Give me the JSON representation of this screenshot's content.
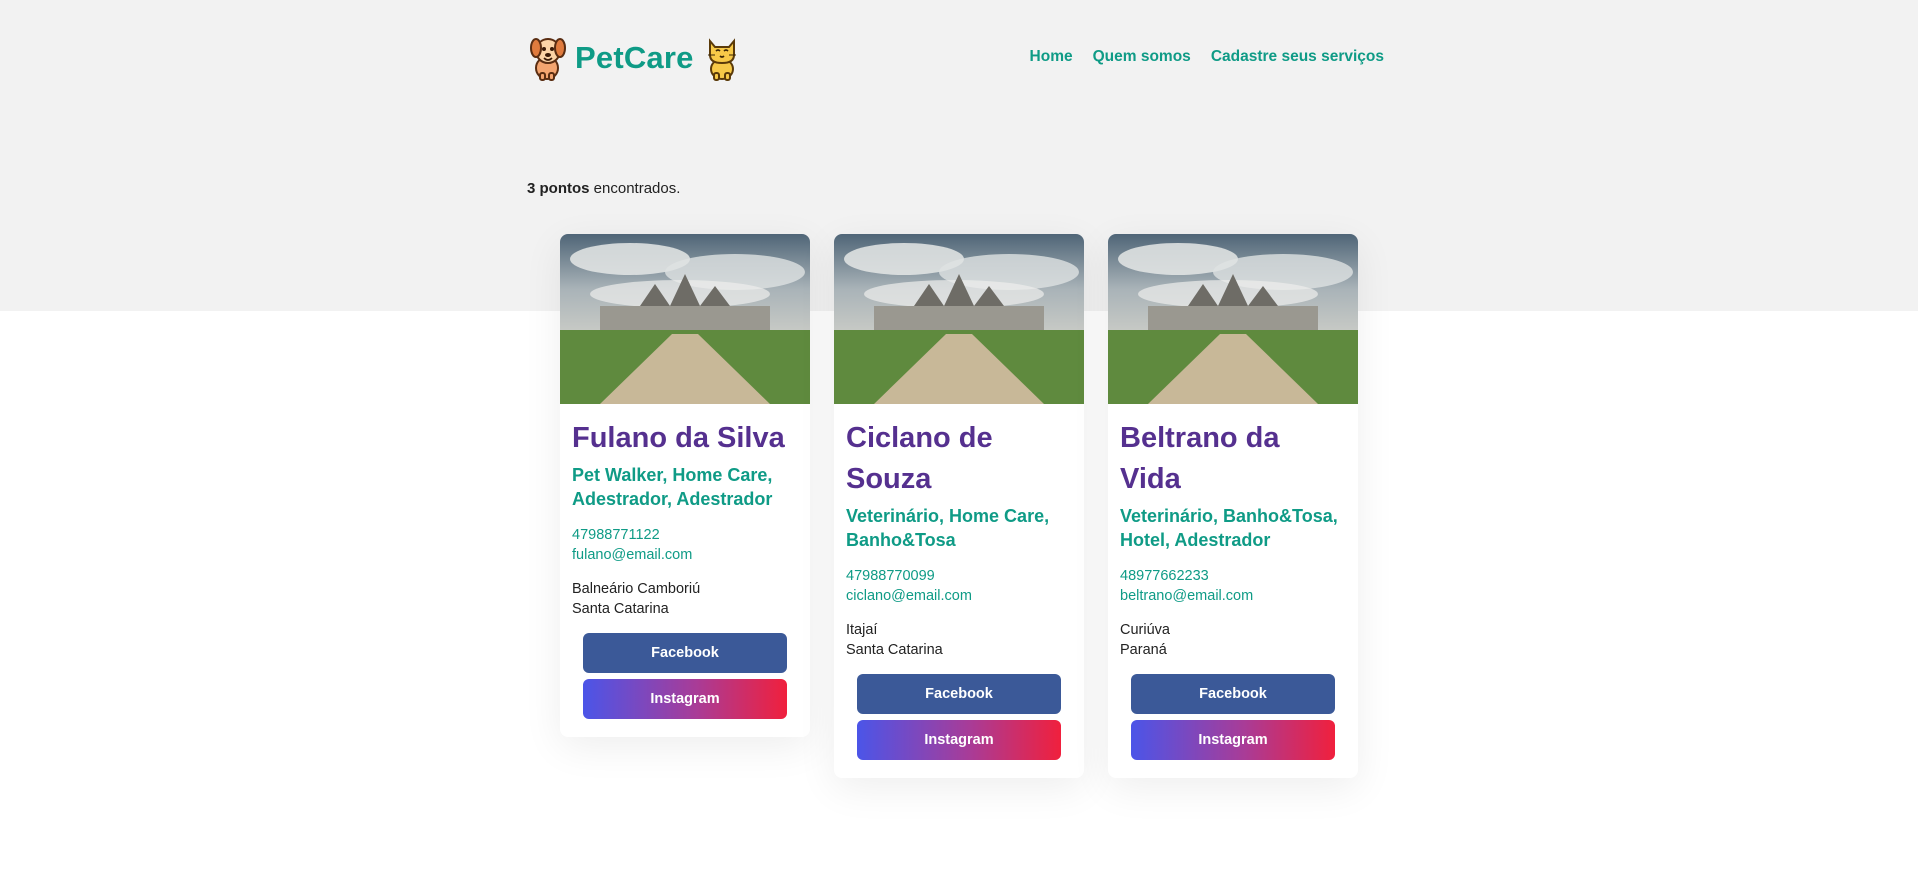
{
  "brand": {
    "name": "PetCare",
    "left_icon": "dog-icon",
    "right_icon": "cat-icon",
    "color": "#0f9b86"
  },
  "nav": {
    "home": "Home",
    "about": "Quem somos",
    "register": "Cadastre seus serviços"
  },
  "results": {
    "count": "3 pontos",
    "suffix": " encontrados."
  },
  "colors": {
    "name": "#55308f",
    "accent": "#0f9b86",
    "facebook": "#3b5998",
    "instagram_start": "#4b55e8",
    "instagram_end": "#f0203d"
  },
  "cards": [
    {
      "name": "Fulano da Silva",
      "services": "Pet Walker, Home Care, Adestrador, Adestrador",
      "phone": "47988771122",
      "email": "fulano@email.com",
      "city": "Balneário Camboriú",
      "state": "Santa Catarina",
      "facebook": "Facebook",
      "instagram": "Instagram"
    },
    {
      "name": "Ciclano de Souza",
      "services": "Veterinário, Home Care, Banho&Tosa",
      "phone": "47988770099",
      "email": "ciclano@email.com",
      "city": "Itajaí",
      "state": "Santa Catarina",
      "facebook": "Facebook",
      "instagram": "Instagram"
    },
    {
      "name": "Beltrano da Vida",
      "services": "Veterinário, Banho&Tosa, Hotel, Adestrador",
      "phone": "48977662233",
      "email": "beltrano@email.com",
      "city": "Curiúva",
      "state": "Paraná",
      "facebook": "Facebook",
      "instagram": "Instagram"
    }
  ]
}
